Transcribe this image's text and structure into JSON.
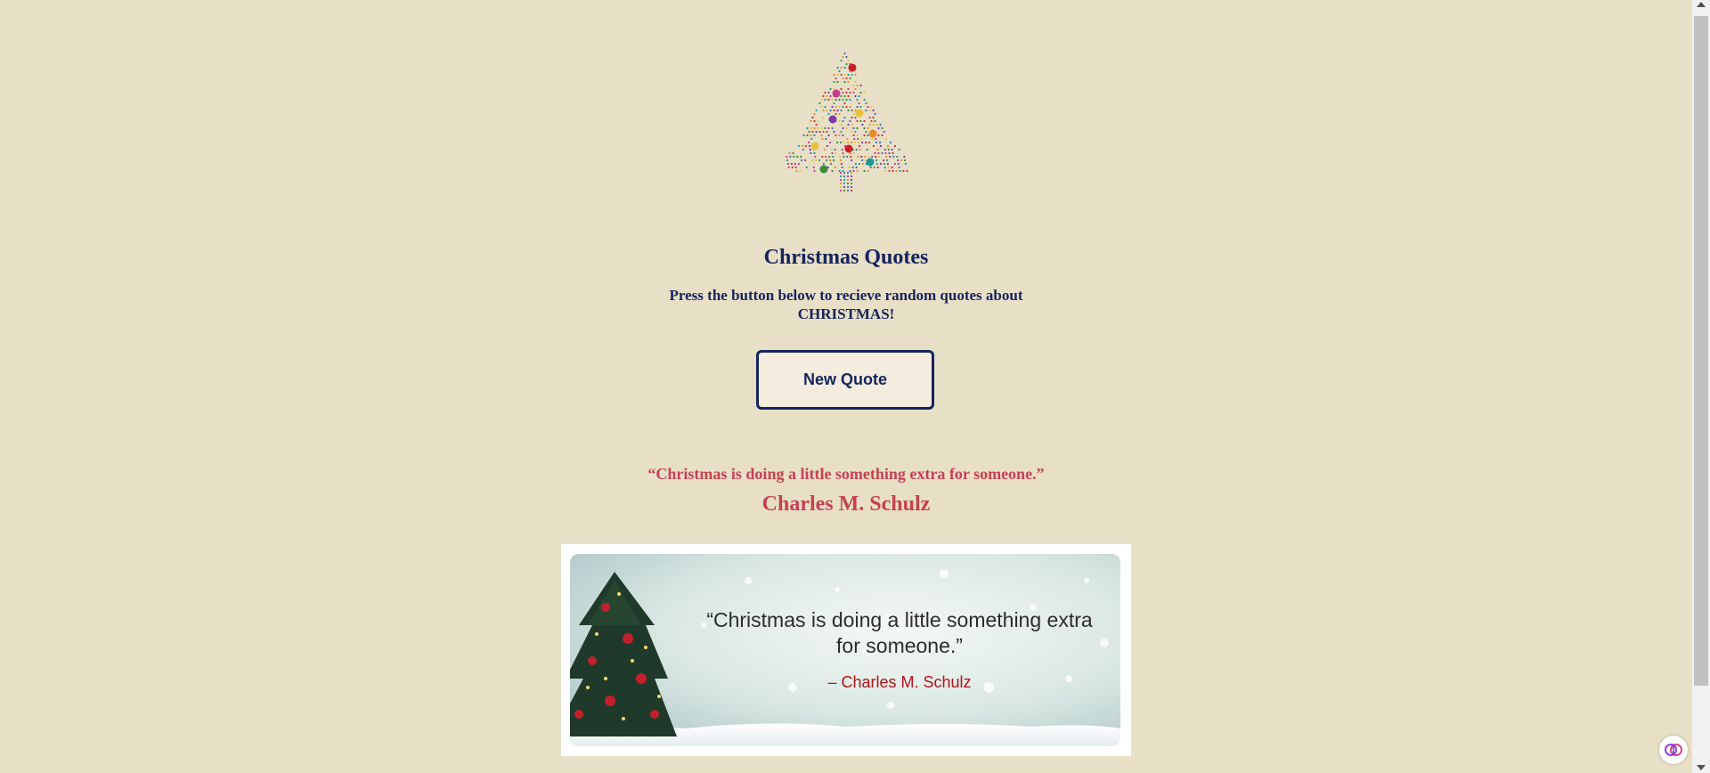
{
  "header": {
    "logo_icon": "christmas-tree-icon",
    "title": "Christmas Quotes",
    "subtitle": "Press the button below to recieve random quotes about CHRISTMAS!"
  },
  "actions": {
    "new_quote_label": "New Quote"
  },
  "current_quote": {
    "text": "“Christmas is doing a little something extra for someone.”",
    "author": "Charles M. Schulz"
  },
  "quote_image": {
    "text": "“Christmas is doing a little something extra for someone.”",
    "author": "– Charles M. Schulz"
  },
  "colors": {
    "background": "#e8dfc7",
    "heading": "#15245c",
    "quote": "#c8414f"
  },
  "browser": {
    "extension_icon": "brain-icon"
  }
}
